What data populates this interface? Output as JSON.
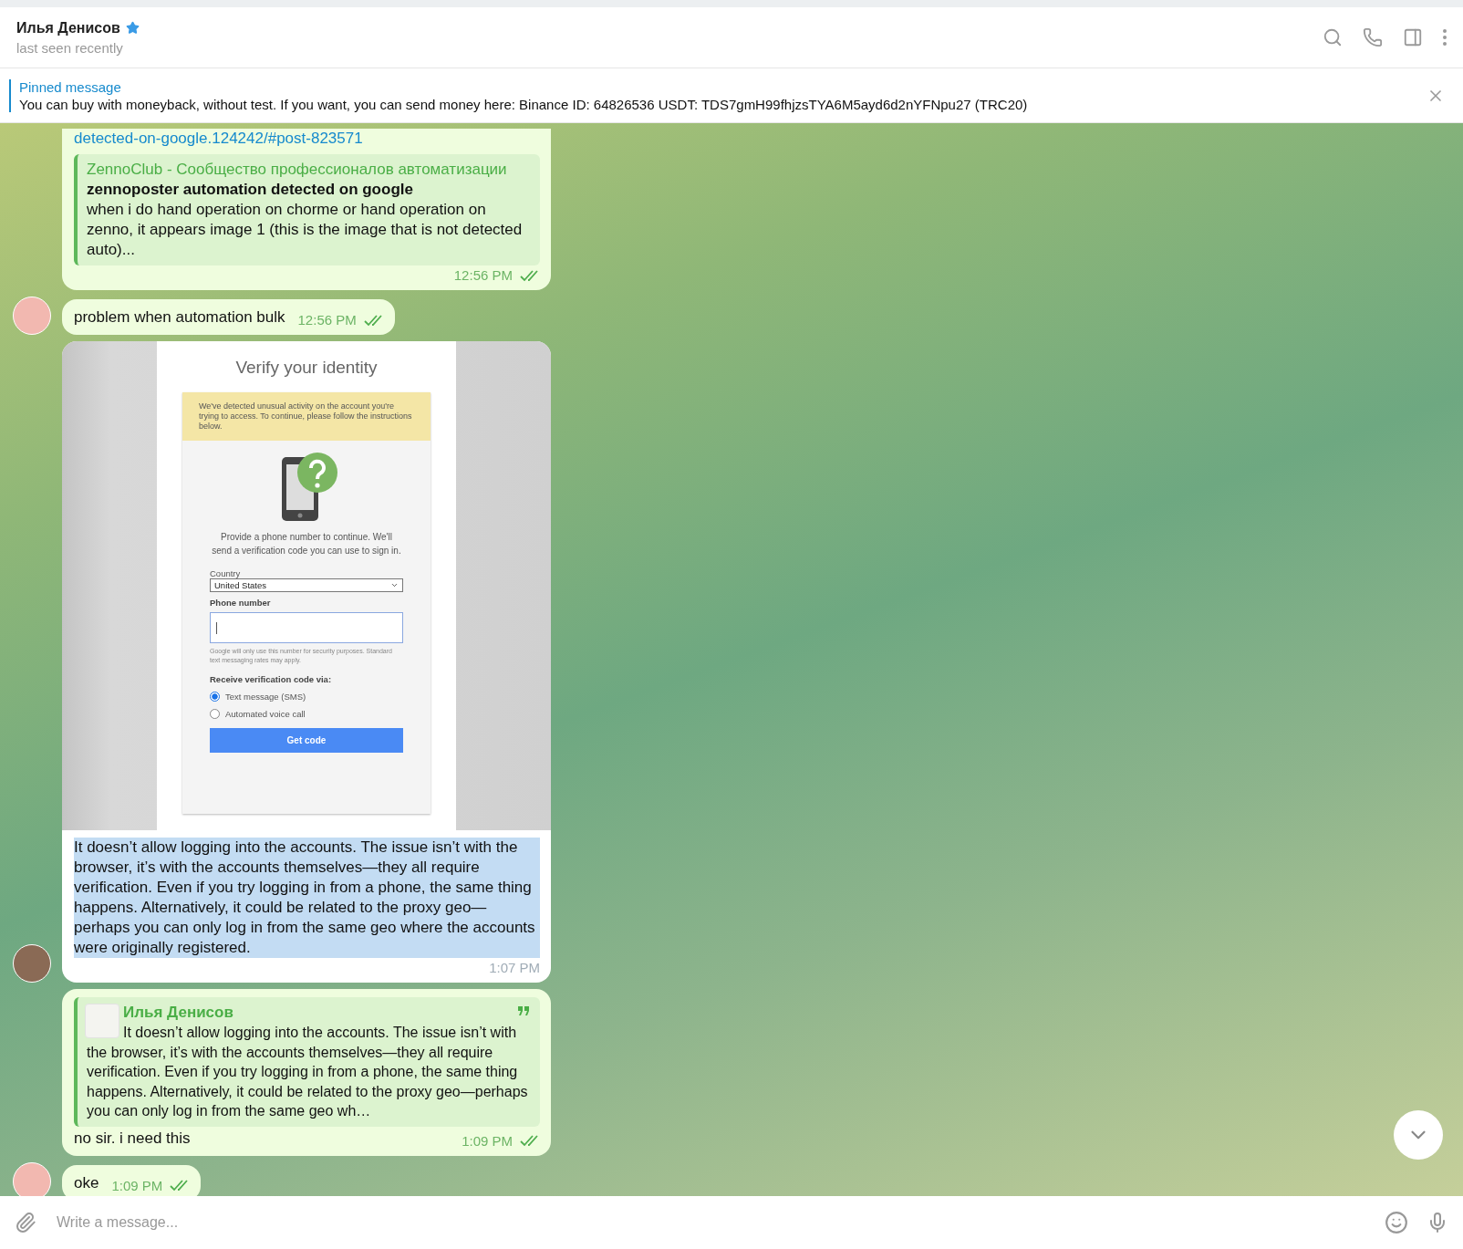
{
  "header": {
    "name": "Илья Денисов",
    "starred": true,
    "status": "last seen recently"
  },
  "pinned": {
    "title": "Pinned message",
    "text": "You can buy with moneyback, without test. If you want, you can send money here: Binance ID: 64826536 USDT: TDS7gmH99fhjzsTYA6M5ayd6d2nYFNpu27 (TRC20)"
  },
  "messages": [
    {
      "kind": "link_preview",
      "outgoing": true,
      "avatar": false,
      "link": "detected-on-google.124242/#post-823571",
      "preview": {
        "site": "ZennoClub - Сообщество профессионалов автоматизации",
        "title": "zennoposter automation detected on google",
        "text": "when i do hand operation on chorme or hand operation on zenno, it appears image 1 (this is the image that is not detected auto)..."
      },
      "time": "12:56 PM",
      "read": true
    },
    {
      "kind": "text",
      "outgoing": true,
      "avatar": true,
      "text": "problem when automation bulk",
      "time": "12:56 PM",
      "read": true
    },
    {
      "kind": "photo_text",
      "outgoing": false,
      "avatar": true,
      "photo": {
        "title": "Verify your identity",
        "notice": "We've detected unusual activity on the account you're trying to access. To continue, please follow the instructions below.",
        "prompt": "Provide a phone number to continue. We'll send a verification code you can use to sign in.",
        "country_label": "Country",
        "country_value": "United States",
        "phone_label": "Phone number",
        "fine_print": "Google will only use this number for security purposes. Standard text messaging rates may apply.",
        "method_label": "Receive verification code via:",
        "methods": [
          {
            "label": "Text message (SMS)",
            "selected": true
          },
          {
            "label": "Automated voice call",
            "selected": false
          }
        ],
        "button": "Get code"
      },
      "text": "It doesn’t allow logging into the accounts. The issue isn’t with the browser, it’s with the accounts themselves—they all require verification. Even if you try logging in from a phone, the same thing happens. Alternatively, it could be related to the proxy geo—perhaps you can only log in from the same geo where the accounts were originally registered.",
      "text_selected": true,
      "time": "1:07 PM"
    },
    {
      "kind": "reply",
      "outgoing": true,
      "avatar": false,
      "quote": {
        "author": "Илья Денисов",
        "text": "It doesn’t allow logging into the accounts. The issue isn’t with the browser, it’s with the accounts themselves—they all require verification. Even if you try logging in from a phone, the same thing happens. Alternatively, it could be related to the proxy geo—perhaps you can only log in from the same geo wh…"
      },
      "text": "no sir. i need this",
      "time": "1:09 PM",
      "read": true
    },
    {
      "kind": "text",
      "outgoing": true,
      "avatar": true,
      "text": "oke",
      "time": "1:09 PM",
      "read": true
    }
  ],
  "composer": {
    "placeholder": "Write a message..."
  }
}
